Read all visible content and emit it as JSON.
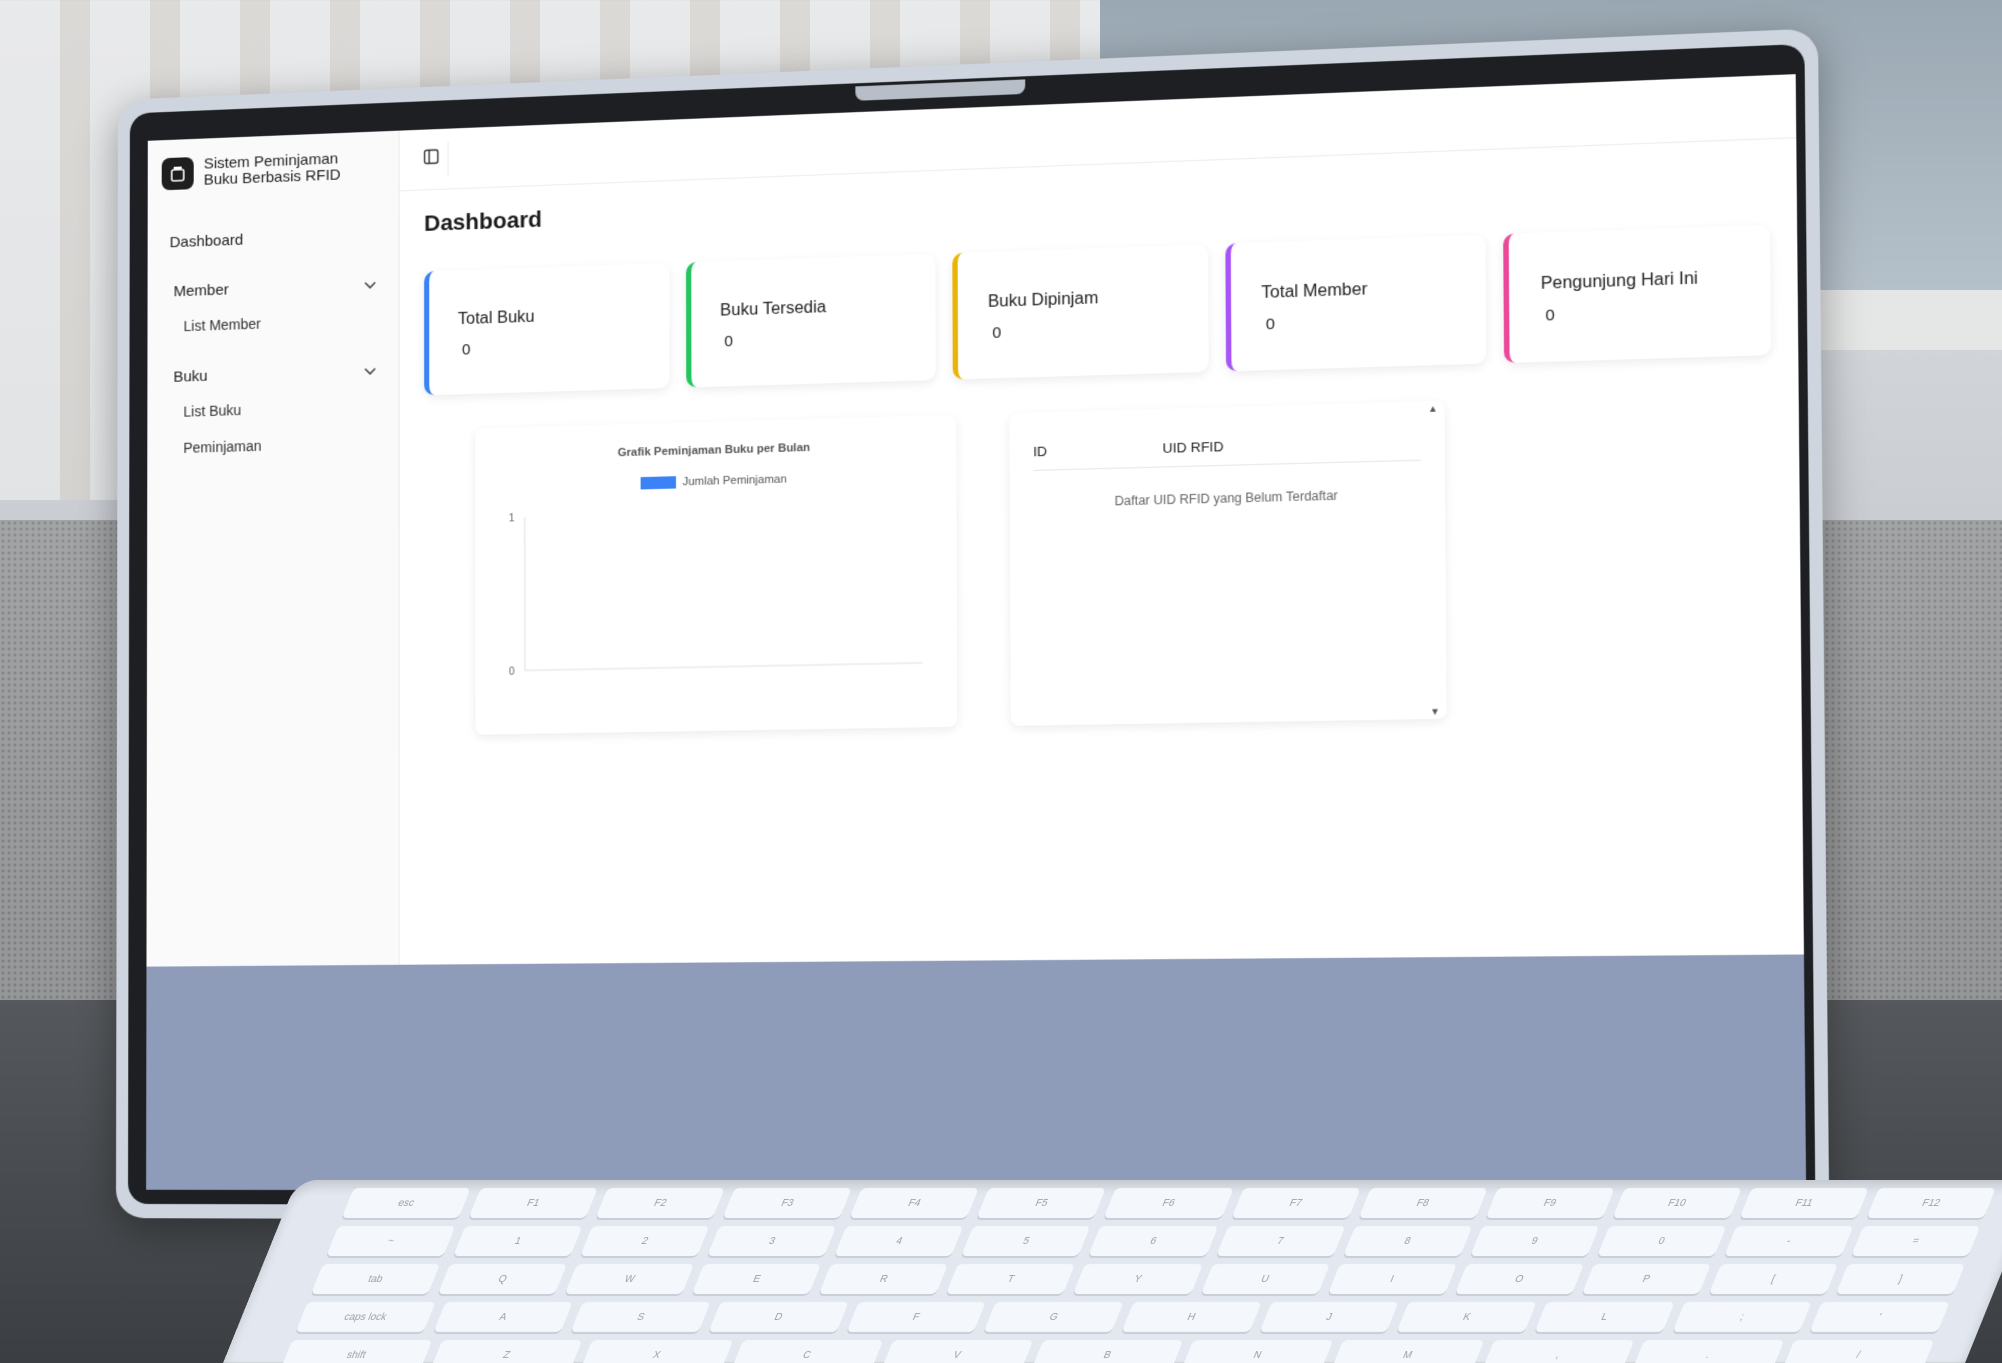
{
  "app": {
    "title": "Sistem Peminjaman Buku Berbasis RFID"
  },
  "sidebar": {
    "dashboard": "Dashboard",
    "groups": [
      {
        "label": "Member",
        "items": [
          "List Member"
        ]
      },
      {
        "label": "Buku",
        "items": [
          "List Buku",
          "Peminjaman"
        ]
      }
    ]
  },
  "page": {
    "title": "Dashboard"
  },
  "stats": [
    {
      "label": "Total Buku",
      "value": "0",
      "color": "#3b82f6"
    },
    {
      "label": "Buku Tersedia",
      "value": "0",
      "color": "#22c55e"
    },
    {
      "label": "Buku Dipinjam",
      "value": "0",
      "color": "#eab308"
    },
    {
      "label": "Total Member",
      "value": "0",
      "color": "#a855f7"
    },
    {
      "label": "Pengunjung Hari Ini",
      "value": "0",
      "color": "#ec4899"
    }
  ],
  "chart_data": {
    "type": "bar",
    "title": "Grafik Peminjaman Buku per Bulan",
    "categories": [],
    "series": [
      {
        "name": "Jumlah Peminjaman",
        "values": [],
        "color": "#3b82f6"
      }
    ],
    "ylim": [
      0,
      1
    ],
    "yticks": [
      "0",
      "1"
    ],
    "legend": "top"
  },
  "uid_table": {
    "columns": [
      "ID",
      "UID RFID"
    ],
    "empty_message": "Daftar UID RFID yang Belum Terdaftar"
  },
  "keyboard": {
    "rows": [
      [
        "esc",
        "F1",
        "F2",
        "F3",
        "F4",
        "F5",
        "F6",
        "F7",
        "F8",
        "F9",
        "F10",
        "F11",
        "F12"
      ],
      [
        "~",
        "1",
        "2",
        "3",
        "4",
        "5",
        "6",
        "7",
        "8",
        "9",
        "0",
        "-",
        "="
      ],
      [
        "tab",
        "Q",
        "W",
        "E",
        "R",
        "T",
        "Y",
        "U",
        "I",
        "O",
        "P",
        "[",
        "]"
      ],
      [
        "caps lock",
        "A",
        "S",
        "D",
        "F",
        "G",
        "H",
        "J",
        "K",
        "L",
        ";",
        "'"
      ],
      [
        "shift",
        "Z",
        "X",
        "C",
        "V",
        "B",
        "N",
        "M",
        ",",
        ".",
        "/"
      ]
    ]
  }
}
